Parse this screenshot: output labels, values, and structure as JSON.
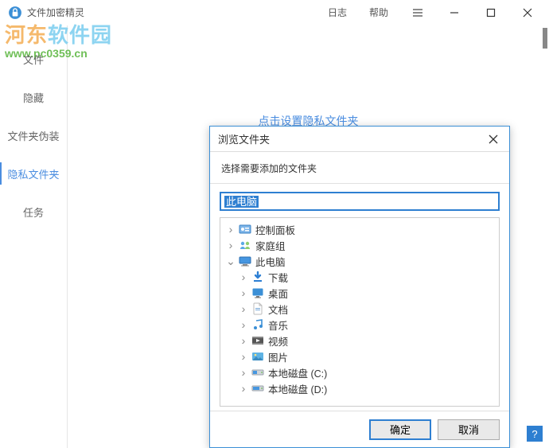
{
  "titlebar": {
    "app_title": "文件加密精灵",
    "log": "日志",
    "help": "帮助"
  },
  "watermark": {
    "cn_prefix": "河东",
    "cn_suffix": "软件园",
    "url": "www.pc0359.cn"
  },
  "sidebar": {
    "items": [
      {
        "label": "文件"
      },
      {
        "label": "隐藏"
      },
      {
        "label": "文件夹伪装"
      },
      {
        "label": "隐私文件夹",
        "active": true
      },
      {
        "label": "任务"
      }
    ]
  },
  "content": {
    "tip": "点击设置隐私文件夹"
  },
  "dialog": {
    "title": "浏览文件夹",
    "subtitle": "选择需要添加的文件夹",
    "path_value": "此电脑",
    "ok": "确定",
    "cancel": "取消",
    "tree": [
      {
        "indent": 0,
        "expander": "›",
        "icon": "control-panel",
        "label": "控制面板"
      },
      {
        "indent": 0,
        "expander": "›",
        "icon": "homegroup",
        "label": "家庭组"
      },
      {
        "indent": 0,
        "expander": "⌄",
        "icon": "this-pc",
        "label": "此电脑"
      },
      {
        "indent": 1,
        "expander": "›",
        "icon": "downloads",
        "label": "下载"
      },
      {
        "indent": 1,
        "expander": "›",
        "icon": "desktop",
        "label": "桌面"
      },
      {
        "indent": 1,
        "expander": "›",
        "icon": "documents",
        "label": "文档"
      },
      {
        "indent": 1,
        "expander": "›",
        "icon": "music",
        "label": "音乐"
      },
      {
        "indent": 1,
        "expander": "›",
        "icon": "videos",
        "label": "视频"
      },
      {
        "indent": 1,
        "expander": "›",
        "icon": "pictures",
        "label": "图片"
      },
      {
        "indent": 1,
        "expander": "›",
        "icon": "disk-c",
        "label": "本地磁盘 (C:)"
      },
      {
        "indent": 1,
        "expander": "›",
        "icon": "disk-d",
        "label": "本地磁盘 (D:)"
      }
    ]
  },
  "help_badge": "?"
}
